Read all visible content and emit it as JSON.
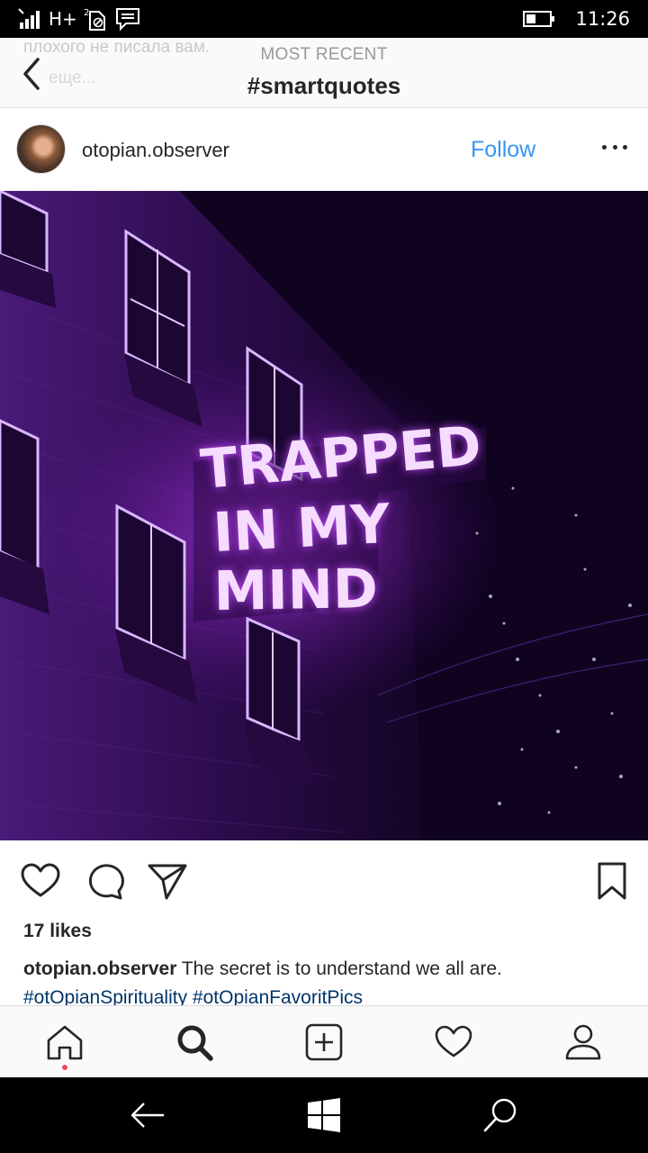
{
  "status_bar": {
    "network": "H+",
    "time": "11:26",
    "signal_icon": "signal-bars-icon",
    "battery_icon": "battery-icon"
  },
  "header": {
    "subtitle": "MOST RECENT",
    "title": "#smartquotes",
    "ghost_text_1": "плохого не писала вам.",
    "ghost_text_2": "еще..."
  },
  "post": {
    "username": "otopian.observer",
    "follow_label": "Follow",
    "image_text": [
      "TRAPPED",
      "IN MY",
      "MIND"
    ],
    "likes": "17 likes",
    "caption_user": "otopian.observer",
    "caption_text": " The secret is to understand we all are.",
    "tags": "#otOpianSpirituality #otOpianFavoritPics"
  },
  "colors": {
    "link_blue": "#3897f0",
    "hashtag": "#003569",
    "notification_dot": "#ed4956",
    "neon": "#f3c8ff"
  }
}
